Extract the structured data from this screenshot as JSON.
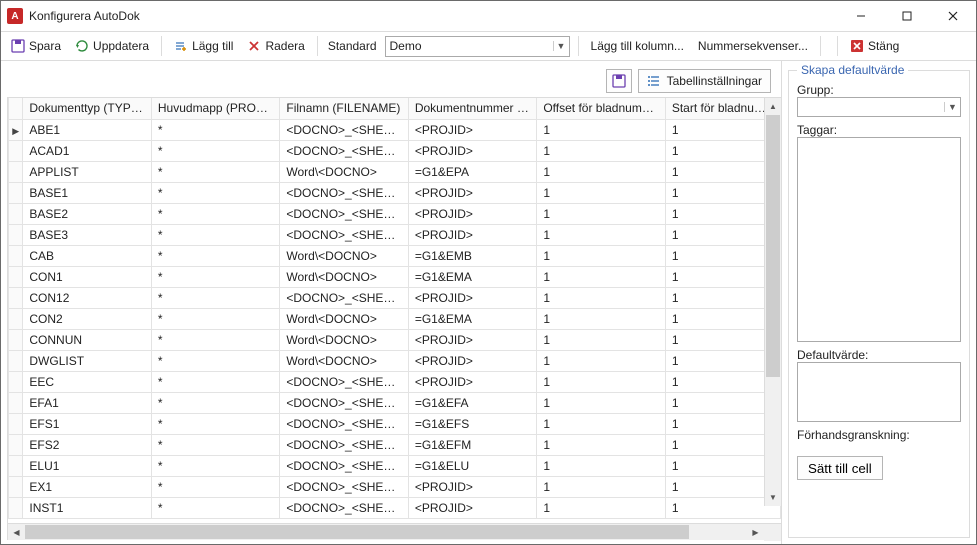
{
  "window": {
    "title": "Konfigurera AutoDok"
  },
  "toolbar": {
    "save": "Spara",
    "refresh": "Uppdatera",
    "add": "Lägg till",
    "delete": "Radera",
    "standard_label": "Standard",
    "standard_value": "Demo",
    "add_column": "Lägg till kolumn...",
    "numseq": "Nummersekvenser...",
    "close": "Stäng"
  },
  "subbar": {
    "table_settings": "Tabellinställningar"
  },
  "grid": {
    "columns": [
      "Dokumenttyp (TYPE_...",
      "Huvudmapp (PROJID)",
      "Filnamn (FILENAME)",
      "Dokumentnummer (KE...",
      "Offset för bladnumme...",
      "Start för bladnummer ..."
    ],
    "rows": [
      {
        "c": [
          "ABE1",
          "*",
          "<DOCNO>_<SHEET>",
          "<PROJID>",
          "1",
          "1"
        ]
      },
      {
        "c": [
          "ACAD1",
          "*",
          "<DOCNO>_<SHEET>",
          "<PROJID>",
          "1",
          "1"
        ]
      },
      {
        "c": [
          "APPLIST",
          "*",
          "Word\\<DOCNO>",
          "=G1&EPA",
          "1",
          "1"
        ]
      },
      {
        "c": [
          "BASE1",
          "*",
          "<DOCNO>_<SHEET>",
          "<PROJID>",
          "1",
          "1"
        ]
      },
      {
        "c": [
          "BASE2",
          "*",
          "<DOCNO>_<SHEET>",
          "<PROJID>",
          "1",
          "1"
        ]
      },
      {
        "c": [
          "BASE3",
          "*",
          "<DOCNO>_<SHEET>",
          "<PROJID>",
          "1",
          "1"
        ]
      },
      {
        "c": [
          "CAB",
          "*",
          "Word\\<DOCNO>",
          "=G1&EMB",
          "1",
          "1"
        ]
      },
      {
        "c": [
          "CON1",
          "*",
          "Word\\<DOCNO>",
          "=G1&EMA",
          "1",
          "1"
        ]
      },
      {
        "c": [
          "CON12",
          "*",
          "<DOCNO>_<SHEET>",
          "<PROJID>",
          "1",
          "1"
        ]
      },
      {
        "c": [
          "CON2",
          "*",
          "Word\\<DOCNO>",
          "=G1&EMA",
          "1",
          "1"
        ]
      },
      {
        "c": [
          "CONNUN",
          "*",
          "Word\\<DOCNO>",
          "<PROJID>",
          "1",
          "1"
        ]
      },
      {
        "c": [
          "DWGLIST",
          "*",
          "Word\\<DOCNO>",
          "<PROJID>",
          "1",
          "1"
        ]
      },
      {
        "c": [
          "EEC",
          "*",
          "<DOCNO>_<SHEET>",
          "<PROJID>",
          "1",
          "1"
        ]
      },
      {
        "c": [
          "EFA1",
          "*",
          "<DOCNO>_<SHEET>",
          "=G1&EFA",
          "1",
          "1"
        ]
      },
      {
        "c": [
          "EFS1",
          "*",
          "<DOCNO>_<SHEET>",
          "=G1&EFS",
          "1",
          "1"
        ]
      },
      {
        "c": [
          "EFS2",
          "*",
          "<DOCNO>_<SHEET>",
          "=G1&EFM",
          "1",
          "1"
        ]
      },
      {
        "c": [
          "ELU1",
          "*",
          "<DOCNO>_<SHEET>",
          "=G1&ELU",
          "1",
          "1"
        ]
      },
      {
        "c": [
          "EX1",
          "*",
          "<DOCNO>_<SHEET>",
          "<PROJID>",
          "1",
          "1"
        ]
      },
      {
        "c": [
          "INST1",
          "*",
          "<DOCNO>_<SHEET>",
          "<PROJID>",
          "1",
          "1"
        ]
      }
    ]
  },
  "right": {
    "group_title": "Skapa defaultvärde",
    "grupp_label": "Grupp:",
    "grupp_value": "",
    "taggar_label": "Taggar:",
    "taggar_value": "",
    "default_label": "Defaultvärde:",
    "default_value": "",
    "preview_label": "Förhandsgranskning:",
    "preview_value": "",
    "set_cell": "Sätt till cell"
  }
}
